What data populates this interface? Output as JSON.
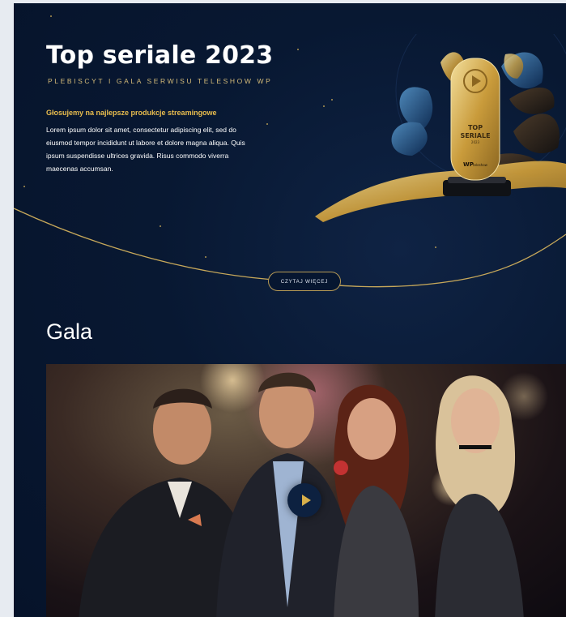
{
  "hero": {
    "title": "Top seriale 2023",
    "subtitle": "PLEBISCYT I GALA SERWISU TELESHOW WP",
    "vote_heading": "Głosujemy na najlepsze produkcje streamingowe",
    "description": "Lorem ipsum dolor sit amet, consectetur adipiscing elit, sed do eiusmod tempor incididunt ut labore et dolore magna aliqua. Quis ipsum suspendisse ultrices gravida. Risus commodo viverra maecenas accumsan.",
    "read_more_label": "CZYTAJ WIĘCEJ"
  },
  "trophy": {
    "line1": "TOP",
    "line2": "SERIALE",
    "year": "2023",
    "brand": "WP",
    "brand_sub": "teleshow"
  },
  "gala": {
    "title": "Gala"
  },
  "video": {
    "play_icon": "play-icon"
  },
  "colors": {
    "background": "#081832",
    "gold": "#d3ba78",
    "accent": "#e9bd4e",
    "page_margin": "#e7ebf1"
  }
}
